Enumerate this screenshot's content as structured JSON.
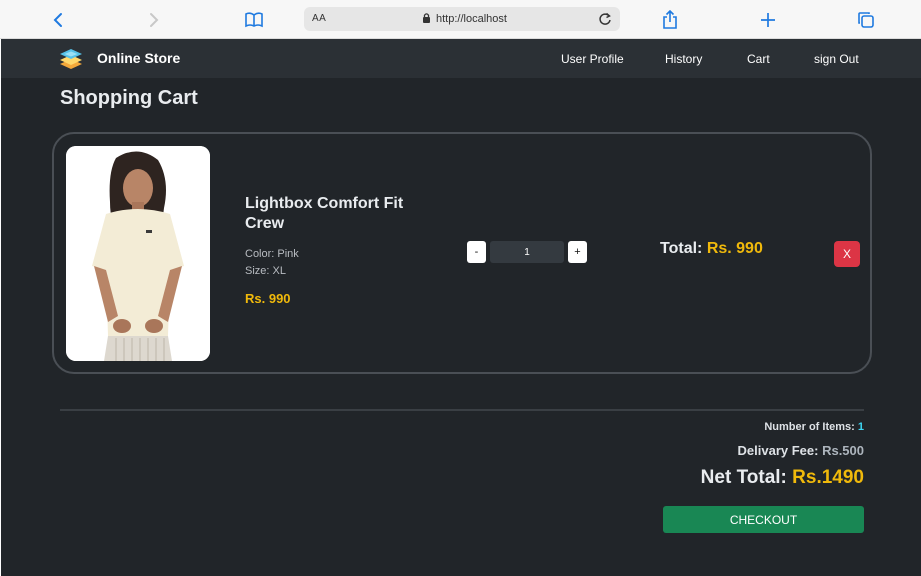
{
  "browser": {
    "aa_label": "AA",
    "url": "http://localhost"
  },
  "navbar": {
    "brand": "Online Store",
    "links": [
      "User Profile",
      "History",
      "Cart",
      "sign Out"
    ]
  },
  "page": {
    "title": "Shopping Cart"
  },
  "cart_items": [
    {
      "name": "Lightbox Comfort Fit Crew",
      "color_line": "Color: Pink",
      "size_line": "Size: XL",
      "price": "Rs. 990",
      "quantity": "1",
      "qty_minus": "-",
      "qty_plus": "+",
      "total_label": "Total:",
      "total_value": "Rs. 990",
      "remove_label": "X"
    }
  ],
  "summary": {
    "items_label": "Number of Items:",
    "items_value": "1",
    "fee_label": "Delivary Fee:",
    "fee_value": "Rs.500",
    "net_label": "Net Total:",
    "net_value": "Rs.1490",
    "checkout_label": "CHECKOUT"
  },
  "colors": {
    "background": "#212529",
    "navbar": "#2b3035",
    "accent_price": "#f0b90b",
    "remove": "#dc3545",
    "checkout": "#198754",
    "items_count": "#3dd5f3"
  },
  "icons": {
    "browser": [
      "chevron-left-icon",
      "chevron-right-icon",
      "book-icon",
      "lock-icon",
      "reload-icon",
      "share-icon",
      "plus-icon",
      "tabs-icon"
    ],
    "brand": "layers-logo-icon"
  }
}
